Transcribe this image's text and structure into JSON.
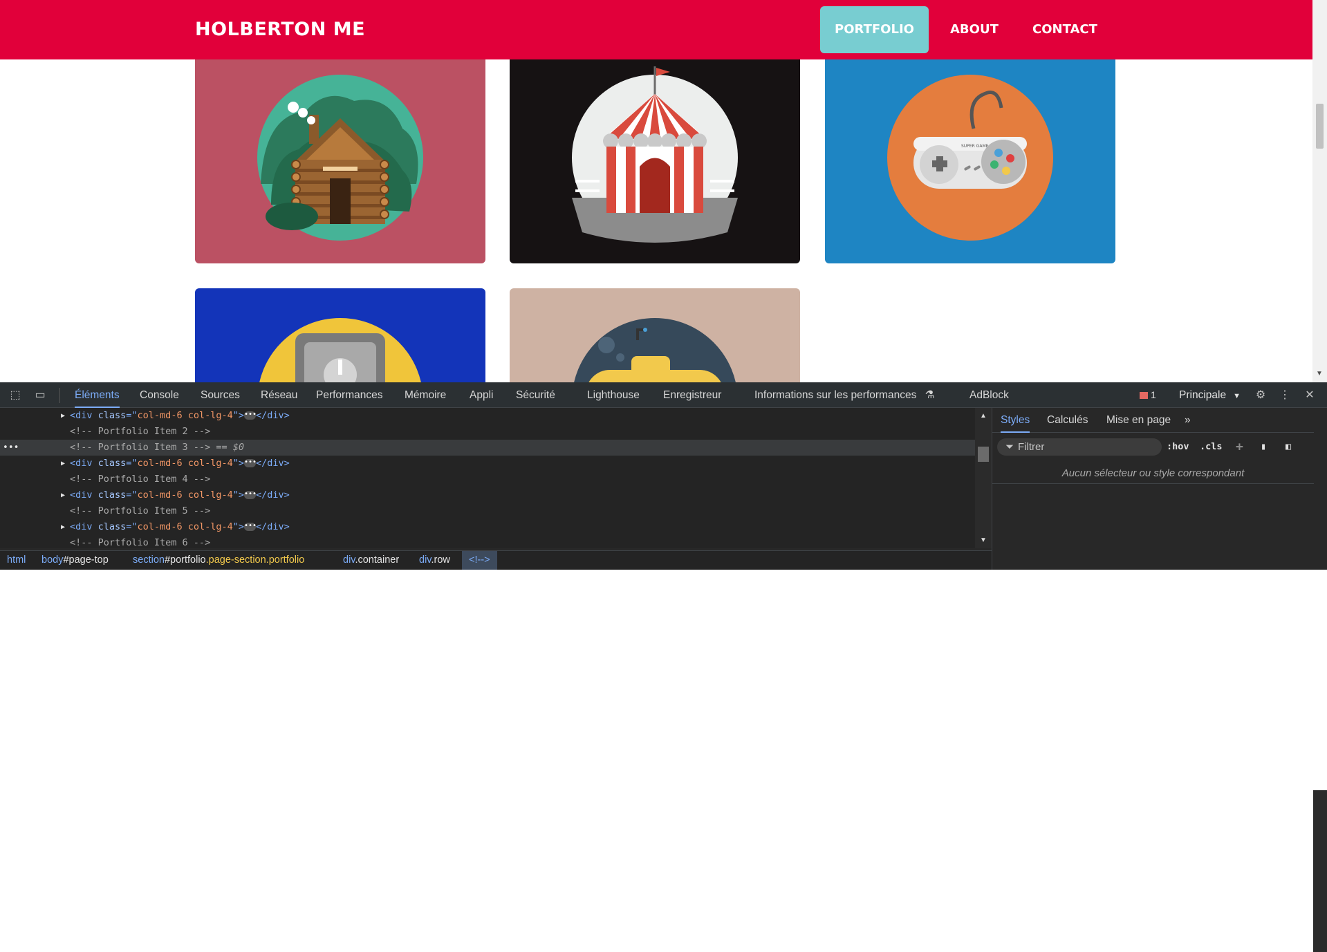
{
  "site": {
    "brand": "HOLBERTON ME",
    "nav": [
      {
        "label": "PORTFOLIO",
        "active": true
      },
      {
        "label": "ABOUT",
        "active": false
      },
      {
        "label": "CONTACT",
        "active": false
      }
    ],
    "colors": {
      "navbar": "#e1003a",
      "active_nav": "#78cdd1"
    },
    "portfolio_items": [
      {
        "icon": "cabin-icon",
        "background": "#bb5163"
      },
      {
        "icon": "circus-tent-icon",
        "background": "#161213"
      },
      {
        "icon": "game-controller-icon",
        "background": "#1e85c3",
        "controller_text": "SUPER GAME"
      },
      {
        "icon": "safe-icon",
        "background": "#1334b9"
      },
      {
        "icon": "submarine-icon",
        "background": "#ceb2a3"
      }
    ]
  },
  "devtools": {
    "tabs": [
      "Éléments",
      "Console",
      "Sources",
      "Réseau",
      "Performances",
      "Mémoire",
      "Appli",
      "Sécurité",
      "Lighthouse",
      "Enregistreur",
      "Informations sur les performances",
      "AdBlock"
    ],
    "active_tab": "Éléments",
    "issues_count": "1",
    "context": "Principale",
    "dom_lines": [
      {
        "type": "element",
        "tag": "div",
        "attr": "class",
        "value": "col-md-6 col-lg-4"
      },
      {
        "type": "comment",
        "text": "<!-- Portfolio Item 2 -->"
      },
      {
        "type": "comment",
        "text": "<!-- Portfolio Item 3 -->",
        "selected": true,
        "suffix": " == ",
        "var": "$0"
      },
      {
        "type": "element",
        "tag": "div",
        "attr": "class",
        "value": "col-md-6 col-lg-4"
      },
      {
        "type": "comment",
        "text": "<!-- Portfolio Item 4 -->"
      },
      {
        "type": "element",
        "tag": "div",
        "attr": "class",
        "value": "col-md-6 col-lg-4"
      },
      {
        "type": "comment",
        "text": "<!-- Portfolio Item 5 -->"
      },
      {
        "type": "element",
        "tag": "div",
        "attr": "class",
        "value": "col-md-6 col-lg-4"
      },
      {
        "type": "comment",
        "text": "<!-- Portfolio Item 6 -->"
      }
    ],
    "breadcrumbs": [
      {
        "tag": "html",
        "id": "",
        "cls": ""
      },
      {
        "tag": "body",
        "id": "#page-top",
        "cls": ""
      },
      {
        "tag": "section",
        "id": "#portfolio",
        "cls": ".page-section.portfolio"
      },
      {
        "tag": "div",
        "id": "",
        "cls": ".container"
      },
      {
        "tag": "div",
        "id": "",
        "cls": ".row"
      },
      {
        "tag": "<!--> ",
        "id": "",
        "cls": ""
      }
    ],
    "styles": {
      "tabs": [
        "Styles",
        "Calculés",
        "Mise en page"
      ],
      "active_tab": "Styles",
      "filter_placeholder": "Filtrer",
      "hov": ":hov",
      "cls": ".cls",
      "empty_message": "Aucun sélecteur ou style correspondant"
    }
  }
}
